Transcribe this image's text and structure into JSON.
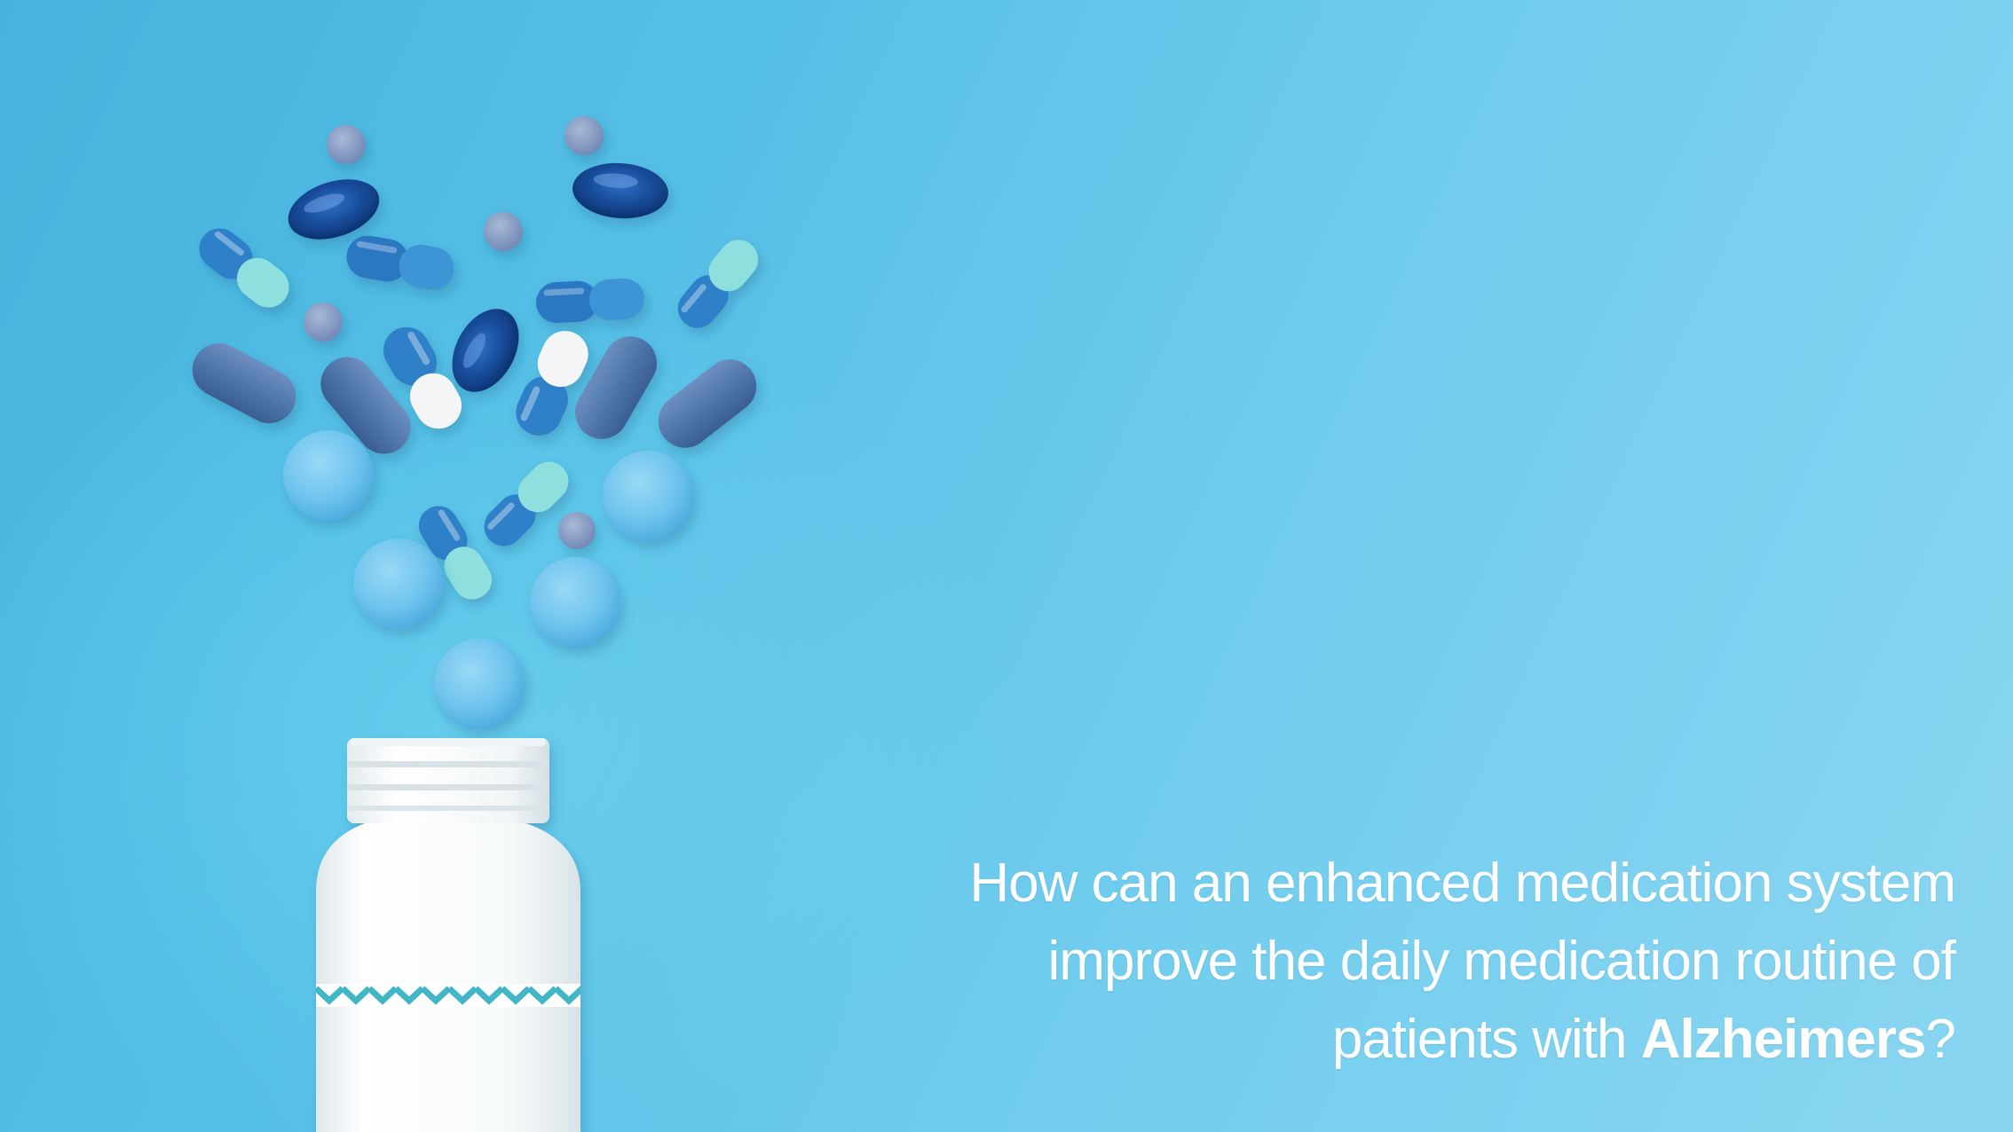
{
  "headline": {
    "line1": "How can an enhanced medication system",
    "line2": "improve the daily medication routine of",
    "line3_prefix": "patients with ",
    "line3_emphasis": "Alzheimers",
    "line3_suffix": "?"
  },
  "colors": {
    "background": "#56bfe6",
    "text": "#ffffff",
    "bottle": "#ffffff",
    "label_pattern": "#3fb6c6",
    "capsule_blue": "#2f80c8",
    "capsule_mint": "#8ee0de",
    "tablet_blue": "#6ec4ee",
    "slate_pill": "#4d74a9",
    "softgel": "#12438c"
  }
}
